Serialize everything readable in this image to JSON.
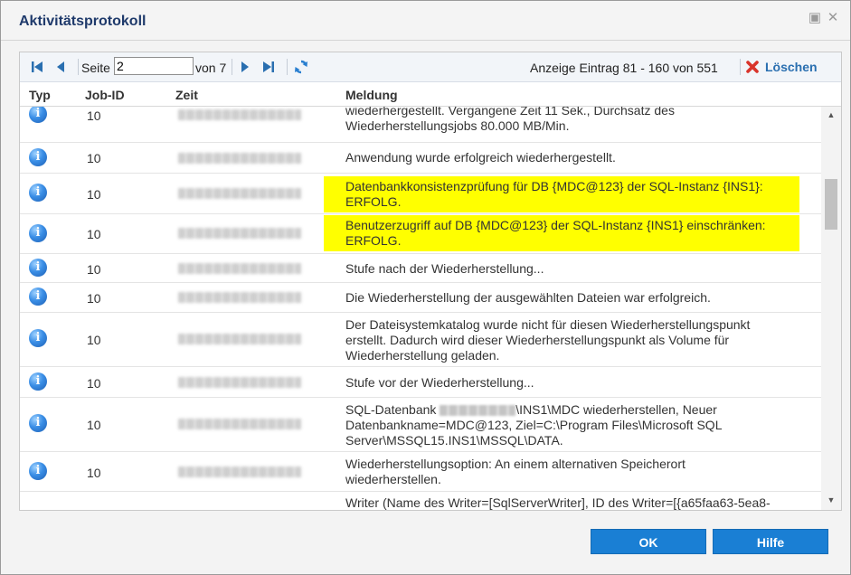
{
  "dialog": {
    "title": "Aktivitätsprotokoll"
  },
  "toolbar": {
    "page_label": "Seite",
    "page_value": "2",
    "of_label": "von 7",
    "info": "Anzeige Eintrag 81 - 160 von 551",
    "delete_label": "Löschen"
  },
  "columns": {
    "typ": "Typ",
    "jobid": "Job-ID",
    "zeit": "Zeit",
    "meldung": "Meldung"
  },
  "rows": [
    {
      "job": "10",
      "msg1": "wiederhergestellt. Vergangene Zeit 11 Sek., Durchsatz des",
      "msg2": "Wiederherstellungsjobs 80.000 MB/Min."
    },
    {
      "job": "10",
      "msg1": "Anwendung wurde erfolgreich wiederhergestellt."
    },
    {
      "job": "10",
      "msg1": "Datenbankkonsistenzprüfung für DB {MDC@123} der SQL-Instanz {INS1}:",
      "msg2": "ERFOLG."
    },
    {
      "job": "10",
      "msg1": "Benutzerzugriff auf DB {MDC@123} der SQL-Instanz {INS1} einschränken:",
      "msg2": "ERFOLG."
    },
    {
      "job": "10",
      "msg1": "Stufe nach der Wiederherstellung..."
    },
    {
      "job": "10",
      "msg1": "Die Wiederherstellung der ausgewählten Dateien war erfolgreich."
    },
    {
      "job": "10",
      "msg1": "Der Dateisystemkatalog wurde nicht für diesen Wiederherstellungspunkt",
      "msg2": "erstellt. Dadurch wird dieser Wiederherstellungspunkt als Volume für",
      "msg3": "Wiederherstellung geladen."
    },
    {
      "job": "10",
      "msg1": "Stufe vor der Wiederherstellung..."
    },
    {
      "job": "10",
      "msg1_pre": "SQL-Datenbank",
      "msg1_post": "\\INS1\\MDC wiederherstellen, Neuer",
      "msg2": "Datenbankname=MDC@123, Ziel=C:\\Program Files\\Microsoft SQL",
      "msg3": "Server\\MSSQL15.INS1\\MSSQL\\DATA."
    },
    {
      "job": "10",
      "msg1": "Wiederherstellungsoption: An einem alternativen Speicherort",
      "msg2": "wiederherstellen."
    },
    {
      "msg1": "Writer (Name des Writer=[SqlServerWriter], ID des Writer=[{a65faa63-5ea8-"
    }
  ],
  "buttons": {
    "ok": "OK",
    "help": "Hilfe"
  },
  "colors": {
    "accent": "#1a7fd4",
    "highlight": "#ffff00",
    "title": "#1f3a6b"
  }
}
